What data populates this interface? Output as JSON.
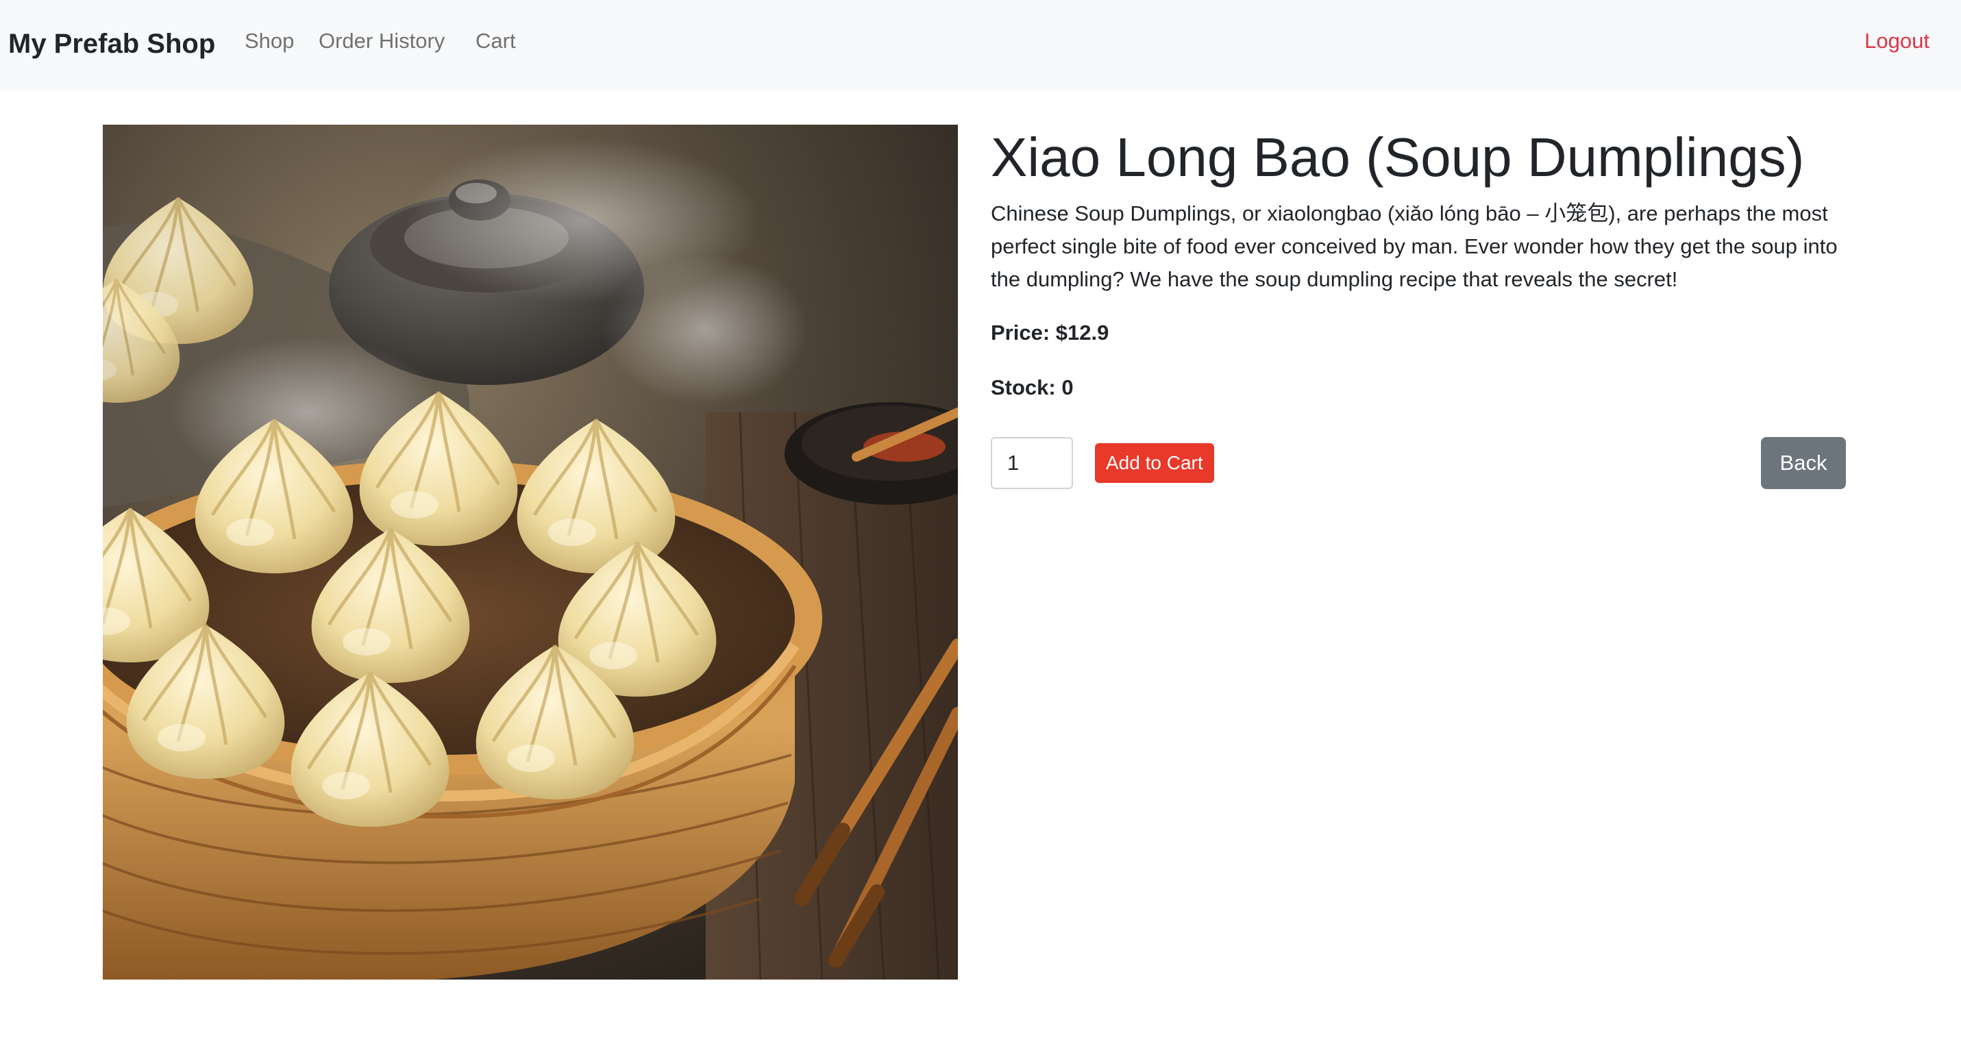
{
  "navbar": {
    "brand": "My Prefab Shop",
    "links": {
      "shop": "Shop",
      "order_history": "Order History",
      "cart": "Cart"
    },
    "logout": "Logout",
    "logout_color": "#dc3545"
  },
  "product": {
    "image_icon": "dumpling-steamer-photo",
    "title": "Xiao Long Bao (Soup Dumplings)",
    "description": "Chinese Soup Dumplings, or xiaolongbao (xiǎo lóng bāo – 小笼包), are perhaps the most perfect single bite of food ever conceived by man. Ever wonder how they get the soup into the dumpling? We have the soup dumpling recipe that reveals the secret!",
    "price_text": "Price: $12.9",
    "stock_text": "Stock: 0",
    "quantity": "1"
  },
  "actions": {
    "add_to_cart": "Add to Cart",
    "back": "Back",
    "add_color": "#e8392a",
    "back_color": "#6c757d"
  }
}
